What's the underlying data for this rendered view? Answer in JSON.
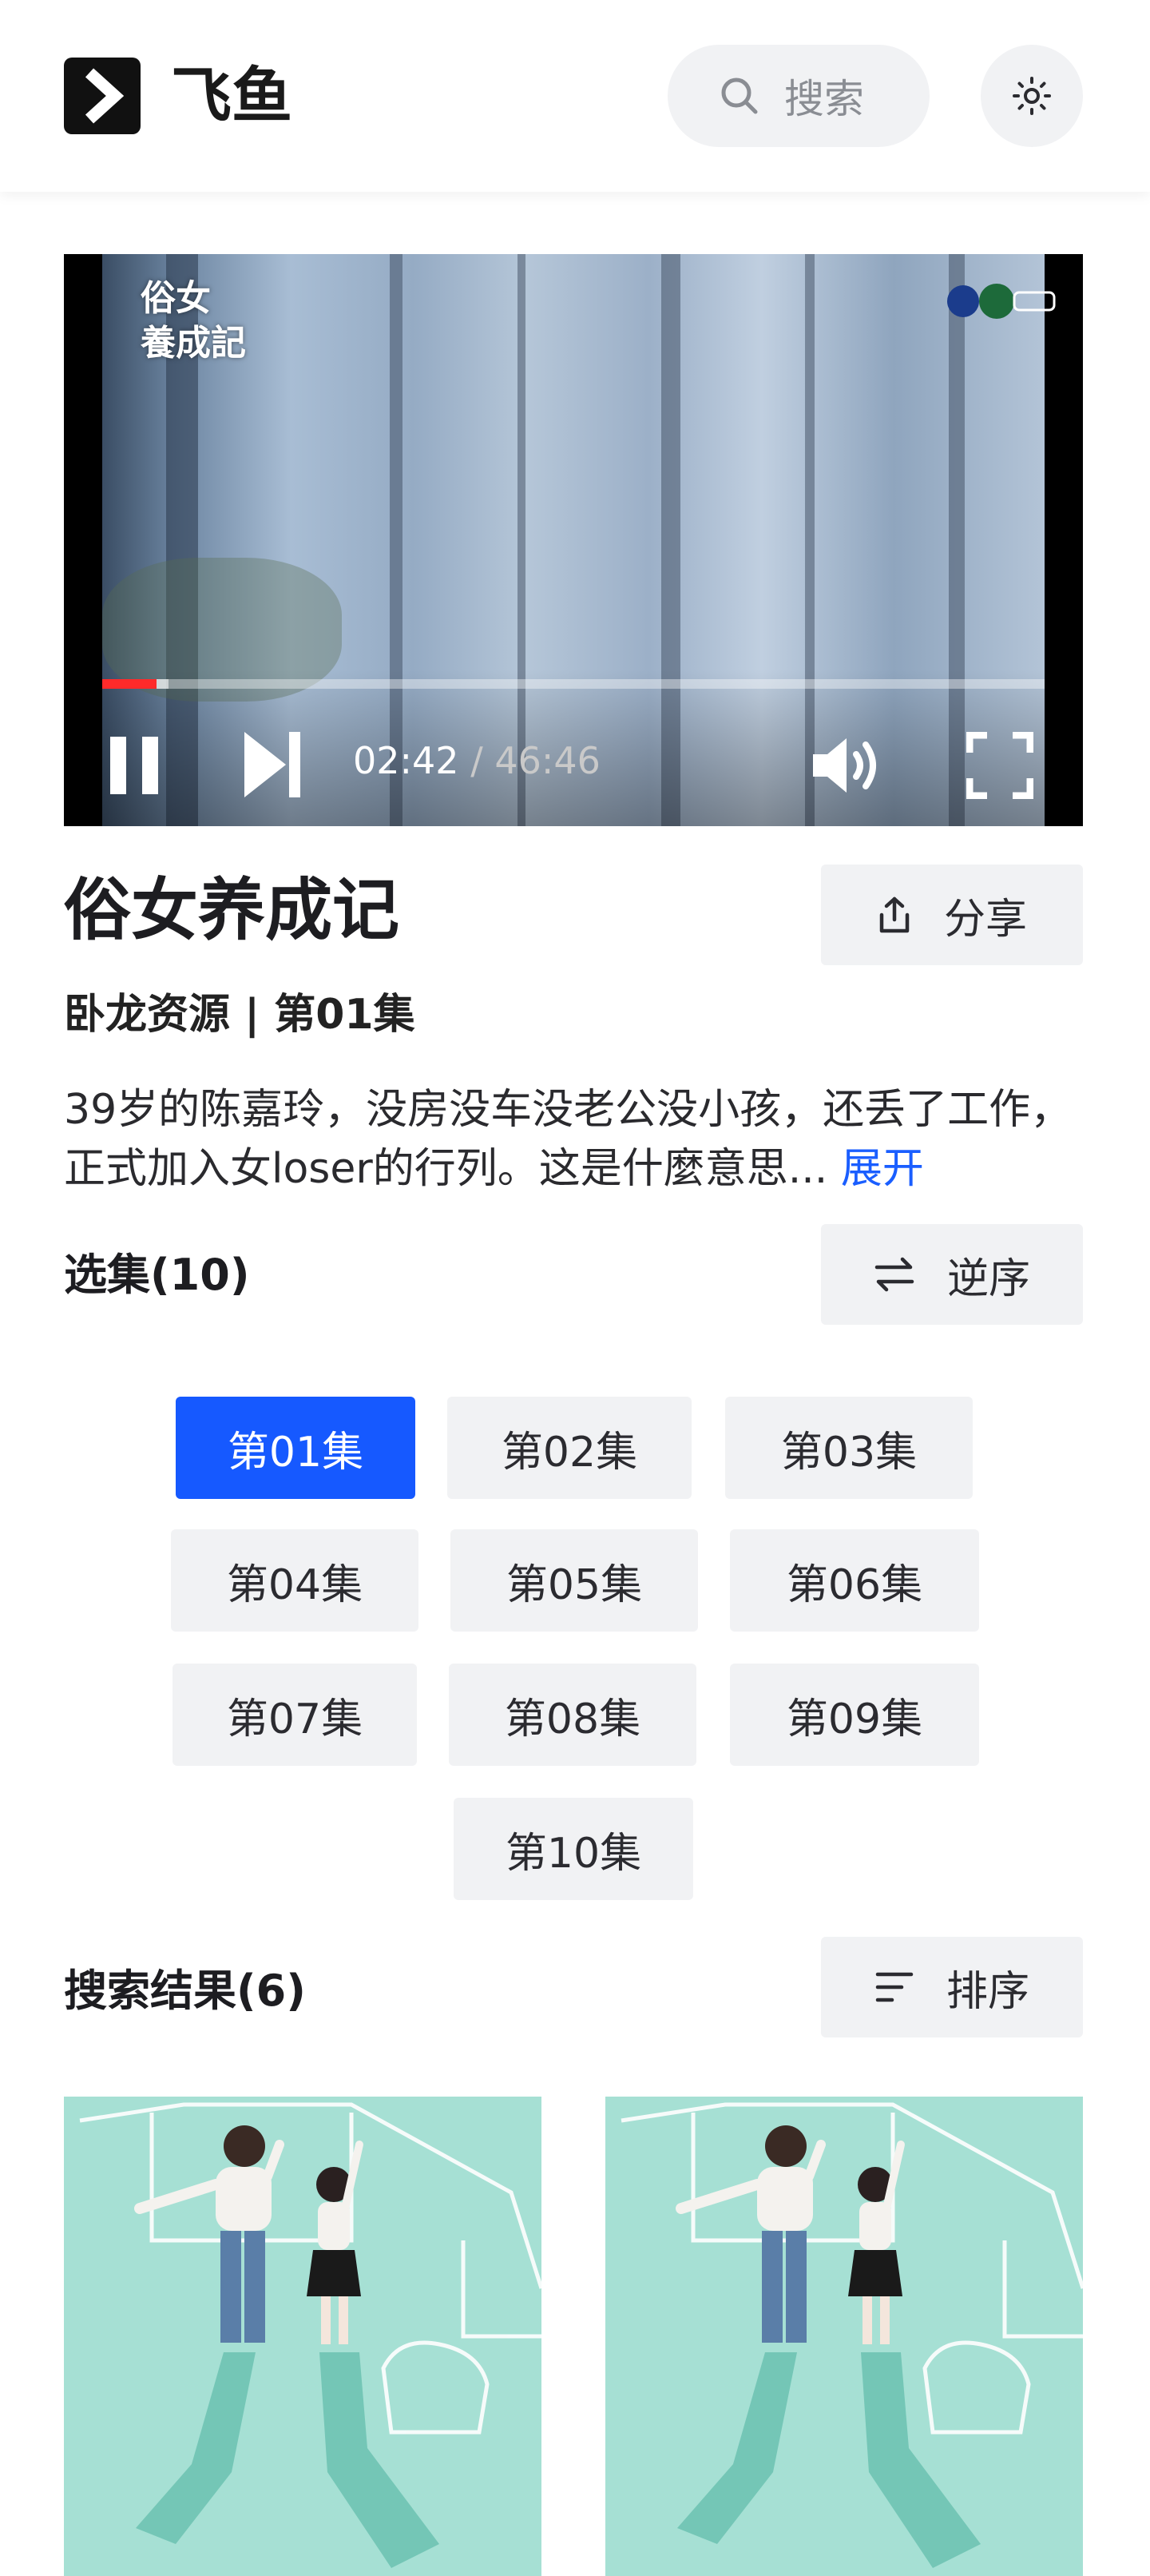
{
  "header": {
    "brand": "飞鱼",
    "search_label": "搜索",
    "icons": {
      "logo": "chevron-right-logo-icon",
      "search": "search-icon",
      "theme": "sun-icon"
    }
  },
  "player": {
    "watermark_title": "俗女\n養成記",
    "current_time": "02:42",
    "separator": " / ",
    "duration": "46:46",
    "progress_fraction": 0.058,
    "buffered_fraction": 0.07,
    "accent_color": "#ff2a2a",
    "icons": {
      "pause": "pause-icon",
      "next": "skip-next-icon",
      "volume": "volume-icon",
      "fullscreen": "fullscreen-icon"
    }
  },
  "detail": {
    "title": "俗女养成记",
    "share_label": "分享",
    "meta": "卧龙资源 | 第01集",
    "description": "39岁的陈嘉玲，没房没车没老公没小孩，还丢了工作，正式加入女loser的行列。这是什麼意思...",
    "expand_label": "展开"
  },
  "episodes": {
    "heading": "选集(10)",
    "reverse_label": "逆序",
    "active_color": "#1659ff",
    "items": [
      {
        "label": "第01集",
        "active": true
      },
      {
        "label": "第02集",
        "active": false
      },
      {
        "label": "第03集",
        "active": false
      },
      {
        "label": "第04集",
        "active": false
      },
      {
        "label": "第05集",
        "active": false
      },
      {
        "label": "第06集",
        "active": false
      },
      {
        "label": "第07集",
        "active": false
      },
      {
        "label": "第08集",
        "active": false
      },
      {
        "label": "第09集",
        "active": false
      },
      {
        "label": "第10集",
        "active": false
      }
    ]
  },
  "results": {
    "heading": "搜索结果(6)",
    "sort_label": "排序",
    "poster_color": "#a6e0d4"
  }
}
